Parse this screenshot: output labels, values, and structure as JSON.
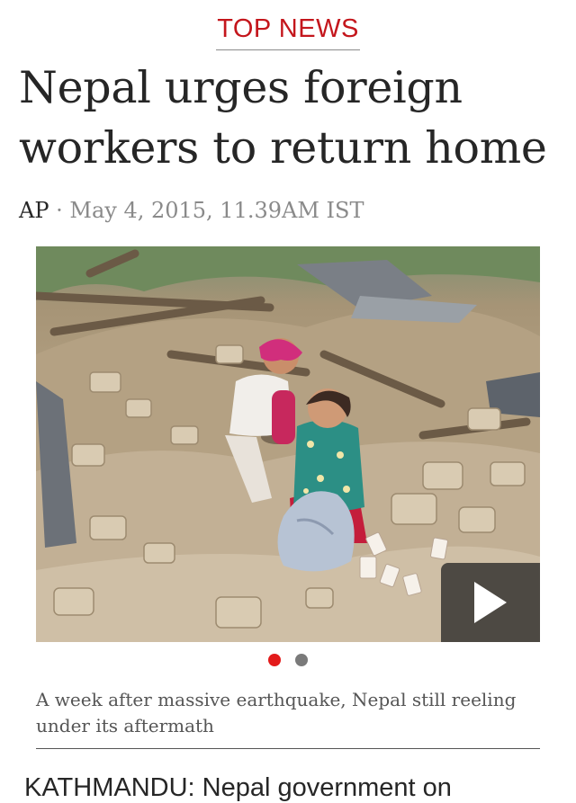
{
  "section": {
    "label": "TOP NEWS"
  },
  "article": {
    "headline": "Nepal urges foreign workers to return home",
    "byline": {
      "source": "AP",
      "separator": " · ",
      "date": "May 4, 2015, 11.39AM IST"
    },
    "media": {
      "icons": {
        "play": "play-icon"
      },
      "carousel": {
        "slide_count": 2,
        "active_index": 0,
        "colors": {
          "active": "#e31b1b",
          "inactive": "#7a7a7a"
        }
      }
    },
    "caption": "A week after massive earthquake, Nepal still reeling under its aftermath",
    "body_start": "KATHMANDU: Nepal government on"
  },
  "colors": {
    "accent": "#c4161c",
    "headline": "#262626",
    "meta": "#8a8a8a"
  }
}
